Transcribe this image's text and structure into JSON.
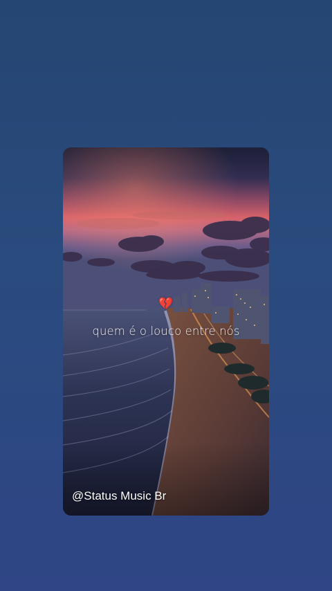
{
  "story": {
    "lyric": "quem é o louco entre nós",
    "emoji": "💔",
    "watermark": "@Status Music Br"
  },
  "colors": {
    "background_top": "#254672",
    "background_bottom": "#2f4585",
    "sky_top": "#2a2a4e",
    "sunset_glow": "#d9636b",
    "sea": "#2a2f4f",
    "sand": "#6a4a3a",
    "text": "#f2eef4"
  },
  "icons": {
    "emoji_name": "broken-heart-icon"
  }
}
